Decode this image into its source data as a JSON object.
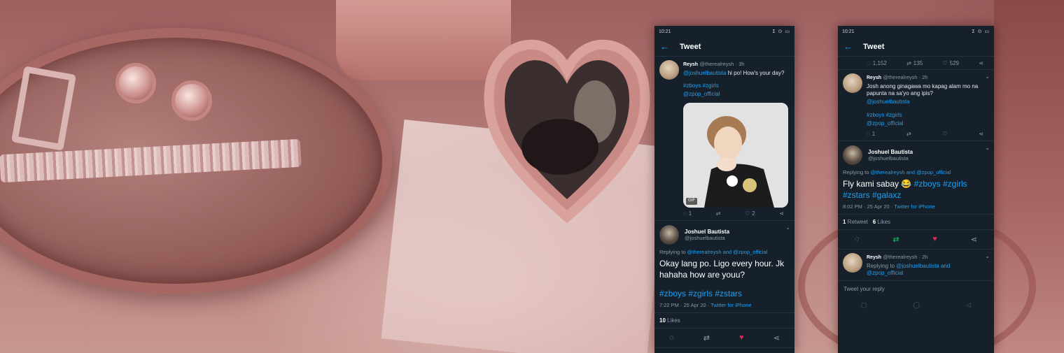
{
  "left_phone": {
    "status_time": "10:21",
    "status_icons": "ⵉ ⊙ ▭",
    "header": {
      "title": "Tweet"
    },
    "parent_tweet": {
      "name": "Reysh",
      "handle_time": "@therealreysh · 3h",
      "mention": "@joshuelbautista",
      "text": " hi po! How's your day?",
      "hashtags": "#zboys #zgirls",
      "mention2": "@zpop_official",
      "gif_label": "GIF",
      "reply_count": "1",
      "retweet_count": "",
      "like_count": "2"
    },
    "main_tweet": {
      "name": "Joshuel Bautista",
      "handle": "@joshuelbautista",
      "replying_prefix": "Replying to ",
      "replying_user1": "@therealreysh",
      "replying_and": " and ",
      "replying_user2": "@zpop_official",
      "text": "Okay lang po. Ligo every hour. Jk hahaha how are youu?",
      "hashtags": "#zboys #zgirls #zstars",
      "timestamp": "7:22 PM · 25 Apr 20 · ",
      "client": "Twitter for iPhone",
      "likes_count": "10",
      "likes_label": " Likes"
    }
  },
  "right_phone": {
    "status_time": "10:21",
    "status_icons": "ⵉ ⊙ ▭",
    "header": {
      "title": "Tweet"
    },
    "top_actions": {
      "replies": "1,152",
      "retweets": "135",
      "likes": "529"
    },
    "parent_tweet": {
      "name": "Reysh",
      "handle_time": "@therealreysh · 2h",
      "text": "Josh anong ginagawa mo kapag alam mo na papunta na sa'yo ang ipis?",
      "mention": "@joshuelbautista",
      "hashtags": "#zboys #zgirls",
      "mention2": "@zpop_official",
      "reply_count": "1"
    },
    "main_tweet": {
      "name": "Joshuel Bautista",
      "handle": "@joshuelbautista",
      "replying_prefix": "Replying to ",
      "replying_user1": "@therealreysh",
      "replying_and": " and ",
      "replying_user2": "@zpop_official",
      "text": "Fly kami sabay 😂 ",
      "hashtags": "#zboys #zgirls #zstars #galaxz",
      "timestamp": "8:02 PM · 25 Apr 20 · ",
      "client": "Twitter for iPhone",
      "retweets_count": "1",
      "retweets_label": " Retweet",
      "likes_count": "6",
      "likes_label": " Likes"
    },
    "reply_tweet": {
      "name": "Reysh",
      "handle_time": "@therealreysh · 2h",
      "replying_prefix": "Replying to ",
      "replying_user1": "@joshuelbautista",
      "replying_and": " and",
      "replying_user2": "@zpop_official"
    },
    "reply_placeholder": "Tweet your reply"
  },
  "colors": {
    "twitter_blue": "#1da1f2",
    "like_red": "#e0245e",
    "retweet_green": "#17bf63",
    "dim_bg": "#15202b"
  }
}
